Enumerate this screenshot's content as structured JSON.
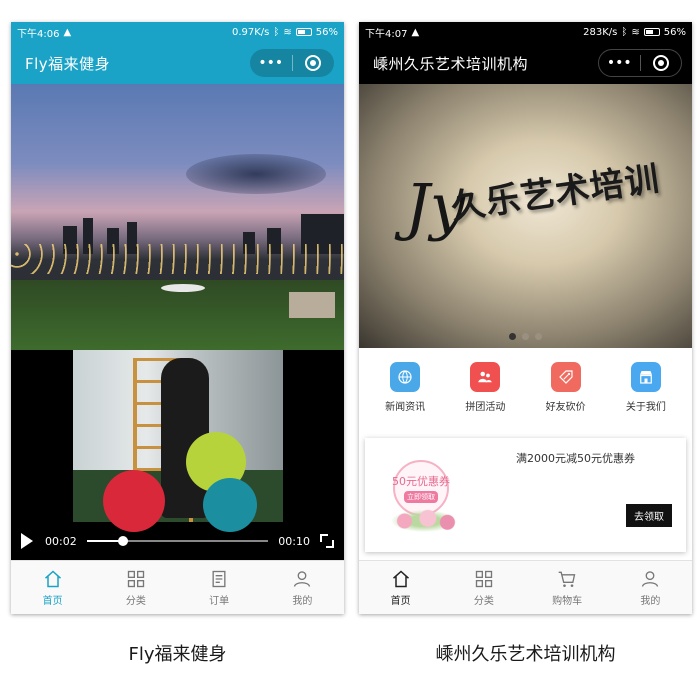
{
  "left": {
    "status": {
      "time": "下午4:06",
      "speed": "0.97K/s",
      "battery": "56%"
    },
    "title": "Fly福来健身",
    "capsule": {
      "more": "•••"
    },
    "video": {
      "current": "00:02",
      "duration": "00:10",
      "progress": 0.2
    },
    "tabs": [
      {
        "label": "首页",
        "icon": "home-icon",
        "active": true
      },
      {
        "label": "分类",
        "icon": "grid-icon",
        "active": false
      },
      {
        "label": "订单",
        "icon": "order-icon",
        "active": false
      },
      {
        "label": "我的",
        "icon": "user-icon",
        "active": false
      }
    ],
    "accent": "#1aa3c6"
  },
  "right": {
    "status": {
      "time": "下午4:07",
      "speed": "283K/s",
      "battery": "56%"
    },
    "title": "嵊州久乐艺术培训机构",
    "capsule": {
      "more": "•••"
    },
    "banner": {
      "logo_letter": "Jy",
      "sign_text": "久乐艺术培训",
      "slide_count": 3,
      "active_slide": 1
    },
    "quick_links": [
      {
        "label": "新闻资讯",
        "icon": "globe-icon",
        "color": "#4aa8e8"
      },
      {
        "label": "拼团活动",
        "icon": "group-icon",
        "color": "#f0504f"
      },
      {
        "label": "好友砍价",
        "icon": "tag-icon",
        "color": "#f06a60"
      },
      {
        "label": "关于我们",
        "icon": "store-icon",
        "color": "#49a8ef"
      }
    ],
    "coupon": {
      "title": "满2000元减50元优惠券",
      "badge_amount": "50元优惠券",
      "badge_tag": "立即领取",
      "button": "去领取"
    },
    "tabs": [
      {
        "label": "首页",
        "icon": "home-icon",
        "active": true
      },
      {
        "label": "分类",
        "icon": "grid-icon",
        "active": false
      },
      {
        "label": "购物车",
        "icon": "cart-icon",
        "active": false
      },
      {
        "label": "我的",
        "icon": "user-icon",
        "active": false
      }
    ]
  },
  "captions": {
    "left": "Fly福来健身",
    "right": "嵊州久乐艺术培训机构"
  }
}
